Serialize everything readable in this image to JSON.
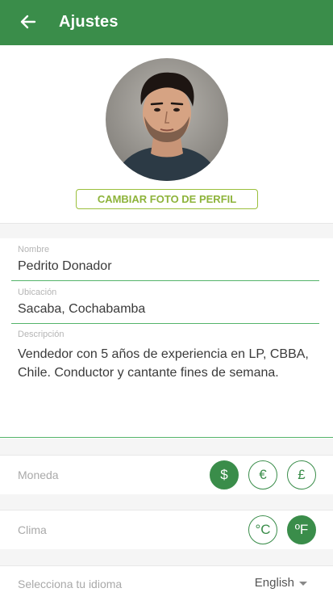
{
  "header": {
    "title": "Ajustes"
  },
  "profile": {
    "change_photo_label": "CAMBIAR FOTO DE PERFIL"
  },
  "fields": {
    "name": {
      "label": "Nombre",
      "value": "Pedrito Donador"
    },
    "location": {
      "label": "Ubicación",
      "value": "Sacaba, Cochabamba"
    },
    "description": {
      "label": "Descripción",
      "value": "Vendedor con 5 años de experiencia en LP, CBBA, Chile. Conductor y cantante fines de semana."
    }
  },
  "currency": {
    "label": "Moneda",
    "options": [
      "$",
      "€",
      "£"
    ],
    "selected": "$"
  },
  "climate": {
    "label": "Clima",
    "options": [
      "°C",
      "ºF"
    ],
    "selected": "ºF"
  },
  "language": {
    "label": "Selecciona tu idioma",
    "value": "English"
  },
  "colors": {
    "primary": "#3a8d4a",
    "accent": "#8db33a",
    "underline": "#54b46a"
  },
  "icons": {
    "back": "arrow-left-icon",
    "caret": "caret-down-icon"
  }
}
